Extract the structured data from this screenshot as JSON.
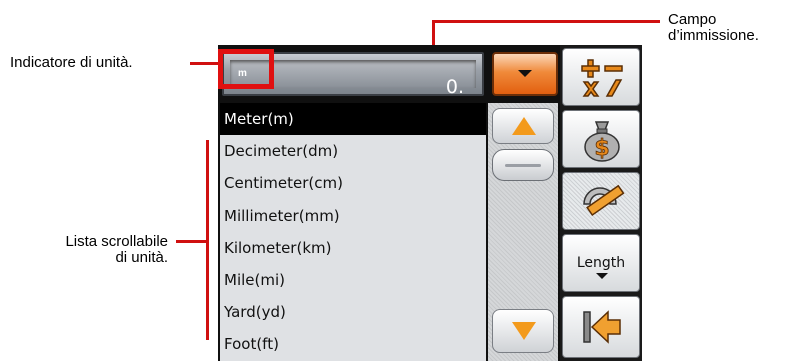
{
  "annotations": {
    "unit_indicator": "Indicatore di unità.",
    "input_field_line1": "Campo",
    "input_field_line2": "d’immissione.",
    "list_line1": "Lista scrollabile",
    "list_line2": "di unità."
  },
  "input": {
    "unit": "m",
    "value": "0."
  },
  "unit_list": [
    "Meter(m)",
    "Decimeter(dm)",
    "Centimeter(cm)",
    "Millimeter(mm)",
    "Kilometer(km)",
    "Mile(mi)",
    "Yard(yd)",
    "Foot(ft)"
  ],
  "selected_unit": "Meter(m)",
  "toolbar": {
    "length_label": "Length",
    "icons": [
      "calculator-icon",
      "currency-bag-icon",
      "ruler-icon",
      "length-mode",
      "back-arrow-icon"
    ]
  },
  "colors": {
    "highlight": "#e01010",
    "accent_orange": "#f08a3a",
    "selected_row": "#000000"
  }
}
